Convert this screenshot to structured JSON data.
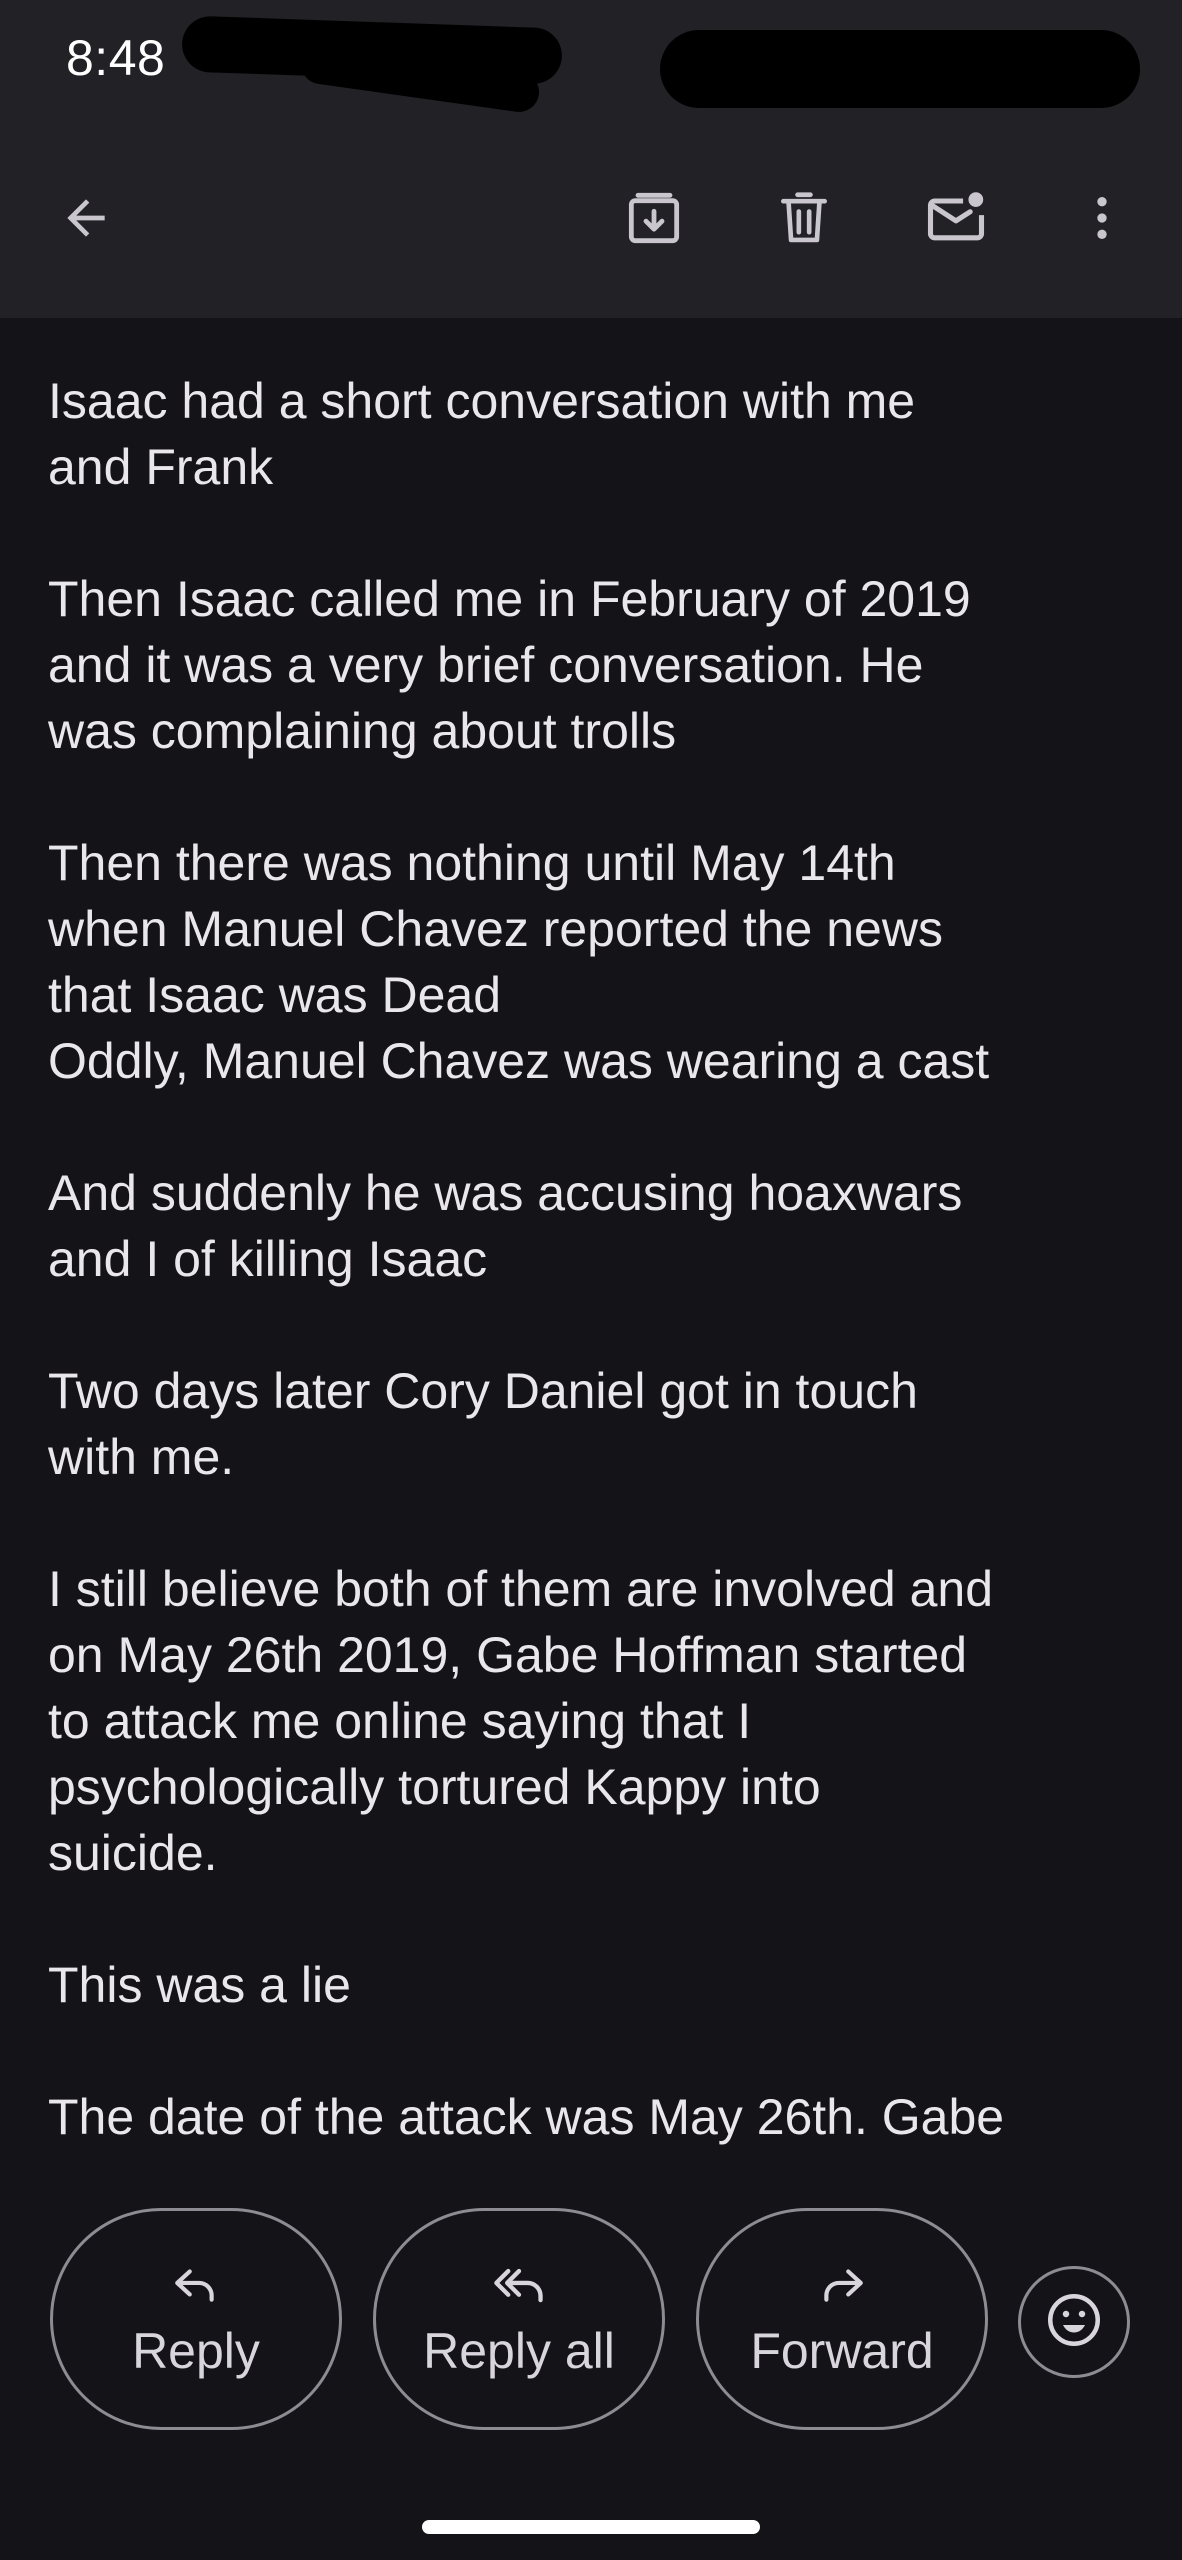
{
  "status_bar": {
    "time": "8:48"
  },
  "app_bar": {
    "back_icon": "arrow-left-icon",
    "archive_icon": "archive-icon",
    "delete_icon": "trash-icon",
    "mark_unread_icon": "mail-unread-icon",
    "more_icon": "more-vert-icon"
  },
  "message": {
    "paragraphs": [
      "Isaac had a short conversation with me\nand Frank",
      "Then Isaac called me in February of 2019\nand it was a very brief conversation. He\nwas complaining about trolls",
      "Then there was nothing until May 14th\nwhen Manuel Chavez reported the news\nthat Isaac was Dead\nOddly, Manuel Chavez was wearing a cast",
      "And suddenly he was accusing hoaxwars\nand I of killing Isaac",
      "Two days later Cory Daniel got in touch\nwith me.",
      "I still believe both of them are involved and\non May 26th 2019, Gabe Hoffman started\nto attack me online saying that I\npsychologically tortured Kappy into\nsuicide.",
      "This was a lie",
      "The date of the attack was May 26th. Gabe"
    ]
  },
  "actions": {
    "reply_label": "Reply",
    "reply_all_label": "Reply all",
    "forward_label": "Forward",
    "emoji_icon": "emoji-icon"
  },
  "colors": {
    "background": "#141317",
    "app_bar": "#222126",
    "text": "#e9e7ec",
    "outline": "#8e8c93"
  }
}
